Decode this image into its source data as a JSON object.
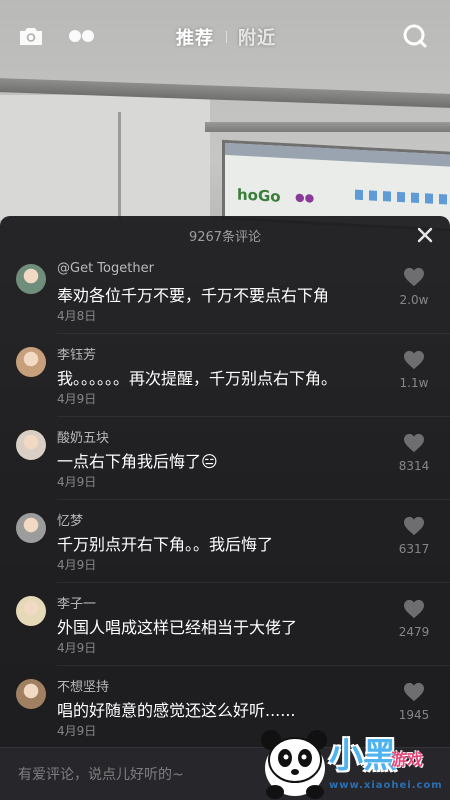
{
  "topbar": {
    "tab_recommend": "推荐",
    "tab_nearby": "附近",
    "icons": [
      "camera-icon",
      "live-dots-icon",
      "search-icon"
    ]
  },
  "panel": {
    "count": "9267条评论",
    "close_icon": "close-icon"
  },
  "comments": [
    {
      "user": "@Get Together",
      "text": "奉劝各位千万不要，千万不要点右下角",
      "date": "4月8日",
      "likes": "2.0w",
      "avatar_color": "#6f8f7c"
    },
    {
      "user": "李钰芳",
      "text": "我。。。。。。再次提醒，千万别点右下角。",
      "date": "4月9日",
      "likes": "1.1w",
      "avatar_color": "#c7a07b"
    },
    {
      "user": "酸奶五块",
      "text": "一点右下角我后悔了😑",
      "date": "4月9日",
      "likes": "8314",
      "avatar_color": "#d9cfc4"
    },
    {
      "user": "忆梦",
      "text": "千万别点开右下角。。我后悔了",
      "date": "4月9日",
      "likes": "6317",
      "avatar_color": "#9c9c9c"
    },
    {
      "user": "李子一",
      "text": "外国人唱成这样已经相当于大佬了",
      "date": "4月9日",
      "likes": "2479",
      "avatar_color": "#e6d9b8"
    },
    {
      "user": "不想坚持",
      "text": "唱的好随意的感觉还这么好听......",
      "date": "4月9日",
      "likes": "1945",
      "avatar_color": "#a08060"
    }
  ],
  "input": {
    "placeholder": "有爱评论，说点儿好听的~"
  },
  "watermark": {
    "title": "小黑",
    "subtitle": "游戏",
    "url": "www.xiaohei.com"
  },
  "colors": {
    "panel_bg": "#1c1c1f",
    "muted_text": "#8d8d8f",
    "watermark_blue": "#4fb3f0",
    "watermark_pink": "#e8457a"
  }
}
